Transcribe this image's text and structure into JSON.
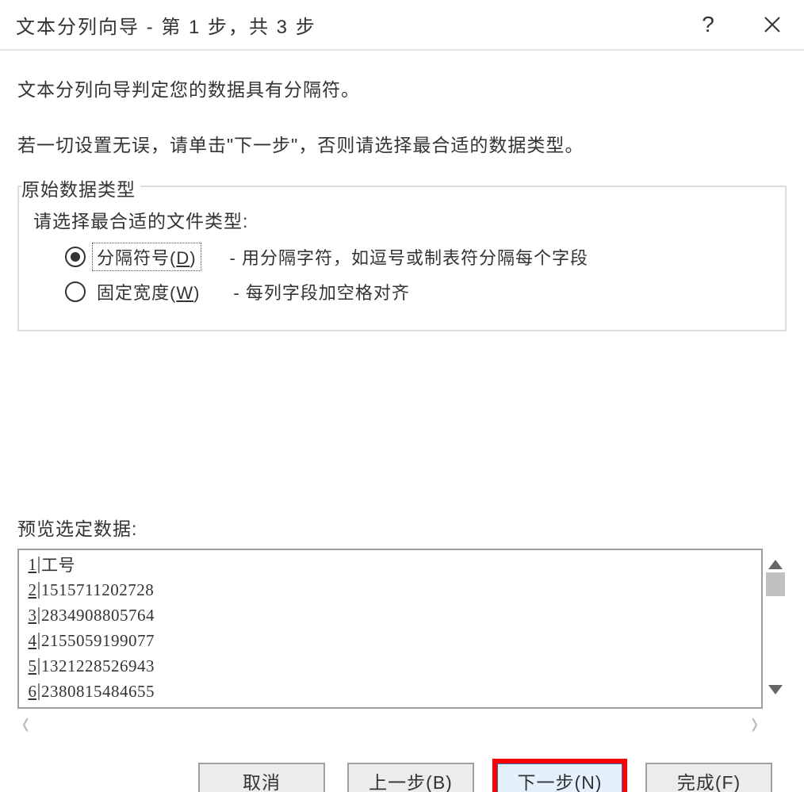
{
  "titlebar": {
    "title": "文本分列向导 - 第 1 步，共 3 步",
    "help_label": "?",
    "close_label": "×"
  },
  "intro": {
    "line1": "文本分列向导判定您的数据具有分隔符。",
    "line2": "若一切设置无误，请单击\"下一步\"，否则请选择最合适的数据类型。"
  },
  "group": {
    "legend": "原始数据类型",
    "prompt": "请选择最合适的文件类型:",
    "options": [
      {
        "label_prefix": "分隔符号(",
        "accel": "D",
        "label_suffix": ")",
        "desc": "- 用分隔字符，如逗号或制表符分隔每个字段",
        "selected": true,
        "focused": true
      },
      {
        "label_prefix": "固定宽度(",
        "accel": "W",
        "label_suffix": ")",
        "desc": "- 每列字段加空格对齐",
        "selected": false,
        "focused": false
      }
    ]
  },
  "preview": {
    "label": "预览选定数据:",
    "rows": [
      {
        "n": "1",
        "v": "工号"
      },
      {
        "n": "2",
        "v": "1515711202728"
      },
      {
        "n": "3",
        "v": "2834908805764"
      },
      {
        "n": "4",
        "v": "2155059199077"
      },
      {
        "n": "5",
        "v": "1321228526943"
      },
      {
        "n": "6",
        "v": "2380815484655"
      }
    ]
  },
  "buttons": {
    "cancel": "取消",
    "back": "上一步(B)",
    "next": "下一步(N)",
    "finish": "完成(F)"
  }
}
